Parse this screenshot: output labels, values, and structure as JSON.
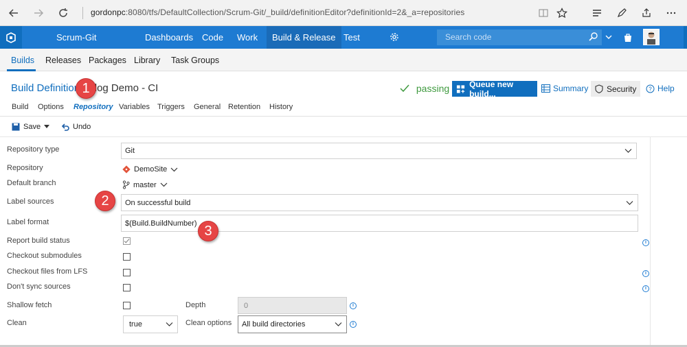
{
  "browser": {
    "url_host": "gordonpc",
    "url_rest": ":8080/tfs/DefaultCollection/Scrum-Git/_build/definitionEditor?definitionId=2&_a=repositories"
  },
  "topbar": {
    "project": "Scrum-Git",
    "nav": [
      "Dashboards",
      "Code",
      "Work",
      "Build & Release",
      "Test"
    ],
    "search_placeholder": "Search code",
    "accent": "#1e7bd2"
  },
  "subnav": {
    "items": [
      "Builds",
      "Releases",
      "Packages",
      "Library",
      "Task Groups"
    ]
  },
  "header": {
    "breadcrumb": "Build Definitions",
    "definition_name": "Blog Demo - CI",
    "status": "passing",
    "queue_label": "Queue new build...",
    "summary_label": "Summary",
    "security_label": "Security",
    "help_label": "Help"
  },
  "tabs": [
    "Build",
    "Options",
    "Repository",
    "Variables",
    "Triggers",
    "General",
    "Retention",
    "History"
  ],
  "toolbar": {
    "save_label": "Save",
    "undo_label": "Undo"
  },
  "form": {
    "repository_type": {
      "label": "Repository type",
      "value": "Git"
    },
    "repository": {
      "label": "Repository",
      "value": "DemoSite"
    },
    "default_branch": {
      "label": "Default branch",
      "value": "master"
    },
    "label_sources": {
      "label": "Label sources",
      "value": "On successful build"
    },
    "label_format": {
      "label": "Label format",
      "value": "$(Build.BuildNumber)"
    },
    "report_build_status": {
      "label": "Report build status",
      "checked": true
    },
    "checkout_submodules": {
      "label": "Checkout submodules",
      "checked": false
    },
    "checkout_lfs": {
      "label": "Checkout files from LFS",
      "checked": false
    },
    "dont_sync": {
      "label": "Don't sync sources",
      "checked": false
    },
    "shallow_fetch": {
      "label": "Shallow fetch",
      "checked": false
    },
    "depth": {
      "label": "Depth",
      "value": "0"
    },
    "clean": {
      "label": "Clean",
      "value": "true"
    },
    "clean_options": {
      "label": "Clean options",
      "value": "All build directories"
    }
  },
  "callouts": [
    "1",
    "2",
    "3"
  ]
}
